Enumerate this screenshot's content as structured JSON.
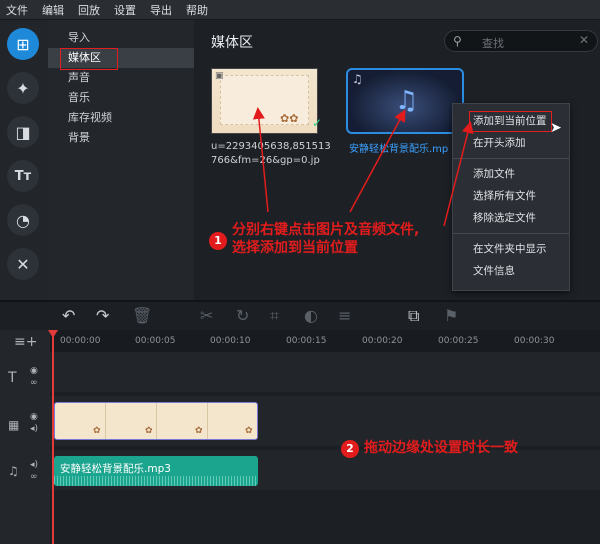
{
  "menu": [
    "文件",
    "编辑",
    "回放",
    "设置",
    "导出",
    "帮助"
  ],
  "sidebar": {
    "items": [
      {
        "label": "导入"
      },
      {
        "label": "媒体区"
      },
      {
        "label": "声音"
      },
      {
        "label": "音乐"
      },
      {
        "label": "库存视频"
      },
      {
        "label": "背景"
      }
    ],
    "active_index": 1
  },
  "media": {
    "title": "媒体区",
    "search_placeholder": "查找",
    "image_file": {
      "name": "u=2293405638,851513766&fm=26&gp=0.jp"
    },
    "audio_file": {
      "name": "安静轻松背景配乐.mp"
    }
  },
  "context_menu": {
    "items": [
      "添加到当前位置",
      "在开头添加",
      "添加文件",
      "选择所有文件",
      "移除选定文件",
      "在文件夹中显示",
      "文件信息"
    ],
    "highlighted": "添加到当前位置"
  },
  "annotations": {
    "step1": {
      "number": "1",
      "line1": "分别右键点击图片及音频文件,",
      "line2": "选择添加到当前位置"
    },
    "step2": {
      "number": "2",
      "text": "拖动边缘处设置时长一致"
    }
  },
  "timeline": {
    "ticks": [
      "00:00:00",
      "00:00:05",
      "00:00:10",
      "00:00:15",
      "00:00:20",
      "00:00:25",
      "00:00:30"
    ],
    "audio_clip": {
      "name": "安静轻松背景配乐.mp3"
    }
  },
  "colors": {
    "accent": "#1e88d9",
    "annotation": "#e21c1c",
    "audio_clip": "#1ca58e",
    "video_border": "#7a79d8"
  }
}
